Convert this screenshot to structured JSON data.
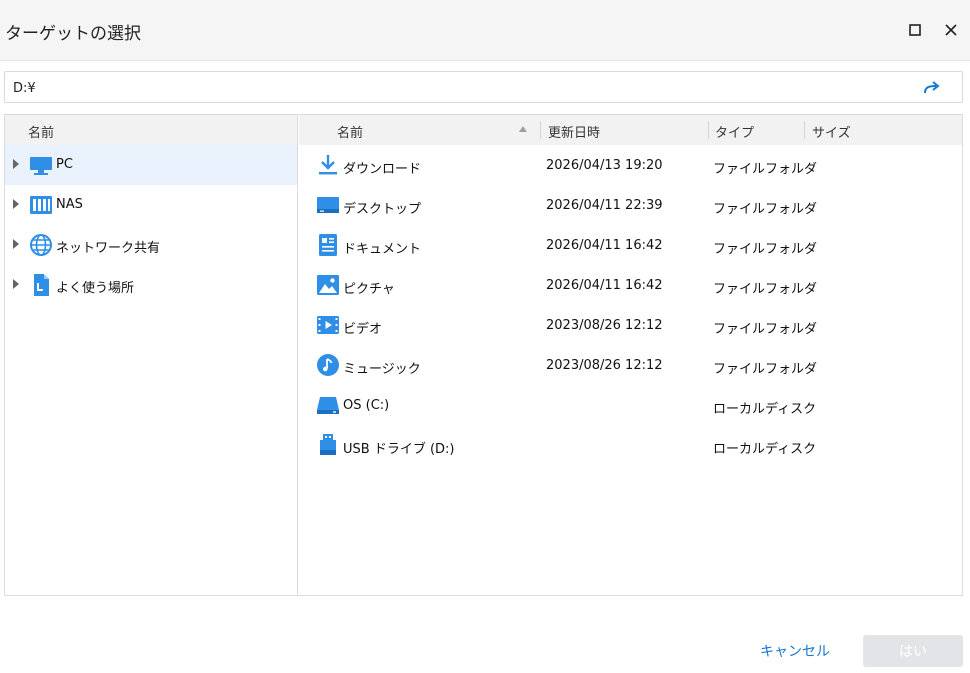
{
  "window": {
    "title": "ターゲットの選択",
    "maximize_icon": "maximize-icon",
    "close_icon": "close-icon"
  },
  "path": {
    "value": "D:¥",
    "go_icon": "redirect-arrow-icon"
  },
  "tree": {
    "header": "名前",
    "items": [
      {
        "label": "PC",
        "icon": "monitor-icon"
      },
      {
        "label": "NAS",
        "icon": "nas-icon"
      },
      {
        "label": "ネットワーク共有",
        "icon": "globe-icon"
      },
      {
        "label": "よく使う場所",
        "icon": "bookmark-file-icon"
      }
    ]
  },
  "list": {
    "headers": {
      "name": "名前",
      "modified": "更新日時",
      "type": "タイプ",
      "size": "サイズ"
    },
    "sort_icon": "sort-up-icon",
    "rows": [
      {
        "name": "ダウンロード",
        "date": "2026/04/13 19:20",
        "type": "ファイルフォルダ",
        "icon": "download-icon"
      },
      {
        "name": "デスクトップ",
        "date": "2026/04/11 22:39",
        "type": "ファイルフォルダ",
        "icon": "desktop-icon"
      },
      {
        "name": "ドキュメント",
        "date": "2026/04/11 16:42",
        "type": "ファイルフォルダ",
        "icon": "document-icon"
      },
      {
        "name": "ピクチャ",
        "date": "2026/04/11 16:42",
        "type": "ファイルフォルダ",
        "icon": "picture-icon"
      },
      {
        "name": "ビデオ",
        "date": "2023/08/26 12:12",
        "type": "ファイルフォルダ",
        "icon": "video-icon"
      },
      {
        "name": "ミュージック",
        "date": "2023/08/26 12:12",
        "type": "ファイルフォルダ",
        "icon": "music-icon"
      },
      {
        "name": "OS (C:)",
        "date": "",
        "type": "ローカルディスク",
        "icon": "hard-drive-icon"
      },
      {
        "name": "USB ドライブ (D:)",
        "date": "",
        "type": "ローカルディスク",
        "icon": "usb-drive-icon"
      }
    ]
  },
  "footer": {
    "cancel_label": "キャンセル",
    "ok_label": "はい"
  },
  "colors": {
    "accent": "#1677d2",
    "icon_blue": "#2f8ee6",
    "selection": "#e9f2fc",
    "disabled_button": "#e2e4e7"
  }
}
